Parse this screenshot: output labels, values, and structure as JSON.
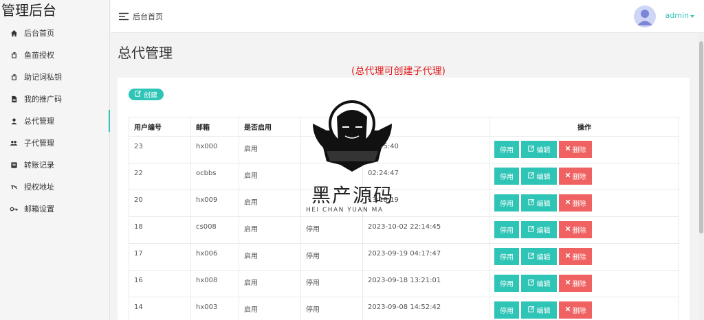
{
  "brand": "管理后台",
  "sidebar": {
    "items": [
      {
        "label": "后台首页",
        "icon": "home-icon"
      },
      {
        "label": "鱼苗授权",
        "icon": "key-icon"
      },
      {
        "label": "助记词私钥",
        "icon": "lock-icon"
      },
      {
        "label": "我的推广码",
        "icon": "file-icon"
      },
      {
        "label": "总代管理",
        "icon": "user-icon"
      },
      {
        "label": "子代管理",
        "icon": "users-icon"
      },
      {
        "label": "转账记录",
        "icon": "list-icon"
      },
      {
        "label": "授权地址",
        "icon": "key2-icon"
      },
      {
        "label": "邮箱设置",
        "icon": "keyhole-icon"
      }
    ],
    "active_index": 4
  },
  "topbar": {
    "breadcrumb": "后台首页",
    "user": "admin"
  },
  "page": {
    "title": "总代管理",
    "notice": "(总代理可创建子代理)",
    "create_label": "创建"
  },
  "table": {
    "headers": [
      "用户编号",
      "邮箱",
      "是否启用",
      "",
      "",
      "操作"
    ],
    "rows": [
      {
        "id": "23",
        "email": "hx000",
        "enabled": "启用",
        "status": "",
        "time": "15:15:40"
      },
      {
        "id": "22",
        "email": "ocbbs",
        "enabled": "启用",
        "status": "",
        "time": "02:24:47"
      },
      {
        "id": "20",
        "email": "hx009",
        "enabled": "启用",
        "status": "",
        "time": "13:18:19"
      },
      {
        "id": "18",
        "email": "cs008",
        "enabled": "启用",
        "status": "停用",
        "time": "2023-10-02 22:14:45"
      },
      {
        "id": "17",
        "email": "hx006",
        "enabled": "启用",
        "status": "停用",
        "time": "2023-09-19 04:17:47"
      },
      {
        "id": "16",
        "email": "hx008",
        "enabled": "启用",
        "status": "停用",
        "time": "2023-09-18 13:21:01"
      },
      {
        "id": "14",
        "email": "hx003",
        "enabled": "启用",
        "status": "停用",
        "time": "2023-09-08 14:52:42"
      }
    ],
    "ops": {
      "stop": "停用",
      "edit": "编辑",
      "delete": "删除"
    }
  },
  "watermark": {
    "title": "黑产源码",
    "sub": "HEI CHAN YUAN MA"
  },
  "colors": {
    "accent": "#2ec4b6",
    "danger": "#f06262",
    "notice": "#e02020"
  }
}
